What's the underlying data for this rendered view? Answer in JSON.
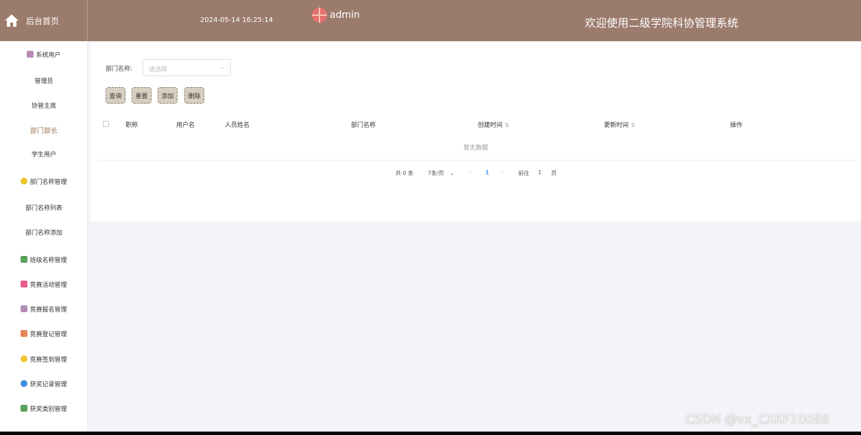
{
  "header": {
    "home_label": "后台首页",
    "datetime": "2024-05-14 16:25:14",
    "username": "admin",
    "system_title": "欢迎使用二级学院科协管理系统"
  },
  "sidebar": {
    "items": [
      {
        "label": "系统用户",
        "icon": "user-group-icon",
        "color": "#b58ab5"
      },
      {
        "label": "管理员"
      },
      {
        "label": "协管主席"
      },
      {
        "label": "部门部长",
        "active": true
      },
      {
        "label": "学生用户"
      },
      {
        "label": "部门名称管理",
        "icon": "department-icon",
        "color": "#f0c62e"
      },
      {
        "label": "部门名称列表"
      },
      {
        "label": "部门名称添加"
      },
      {
        "label": "班级名称管理",
        "icon": "class-icon",
        "color": "#56a35b"
      },
      {
        "label": "竞赛活动管理",
        "icon": "competition-icon",
        "color": "#e85d8c"
      },
      {
        "label": "竞赛报名管理",
        "icon": "signup-icon",
        "color": "#b58ab5"
      },
      {
        "label": "竞赛登记管理",
        "icon": "register-icon",
        "color": "#e8845b"
      },
      {
        "label": "竞赛签到管理",
        "icon": "checkin-icon",
        "color": "#f0c62e"
      },
      {
        "label": "获奖记录管理",
        "icon": "award-icon",
        "color": "#3b8fe0"
      },
      {
        "label": "获奖类别管理",
        "icon": "award-category-icon",
        "color": "#56a35b"
      }
    ]
  },
  "filter": {
    "label": "部门名称:",
    "placeholder": "请选择"
  },
  "buttons": {
    "query": "查询",
    "reset": "重置",
    "add": "添加",
    "delete": "删除"
  },
  "table": {
    "columns": [
      "职称",
      "用户名",
      "人员姓名",
      "部门名称",
      "创建时间",
      "更新时间",
      "操作"
    ],
    "sort_glyph": "⇅",
    "empty_text": "暂无数据"
  },
  "pagination": {
    "total": "共 0 条",
    "page_size": "7条/页",
    "current_page": "1",
    "goto_label": "前往",
    "goto_value": "1",
    "page_suffix": "页"
  },
  "watermark": "CSDN @vx_CXKF10088"
}
